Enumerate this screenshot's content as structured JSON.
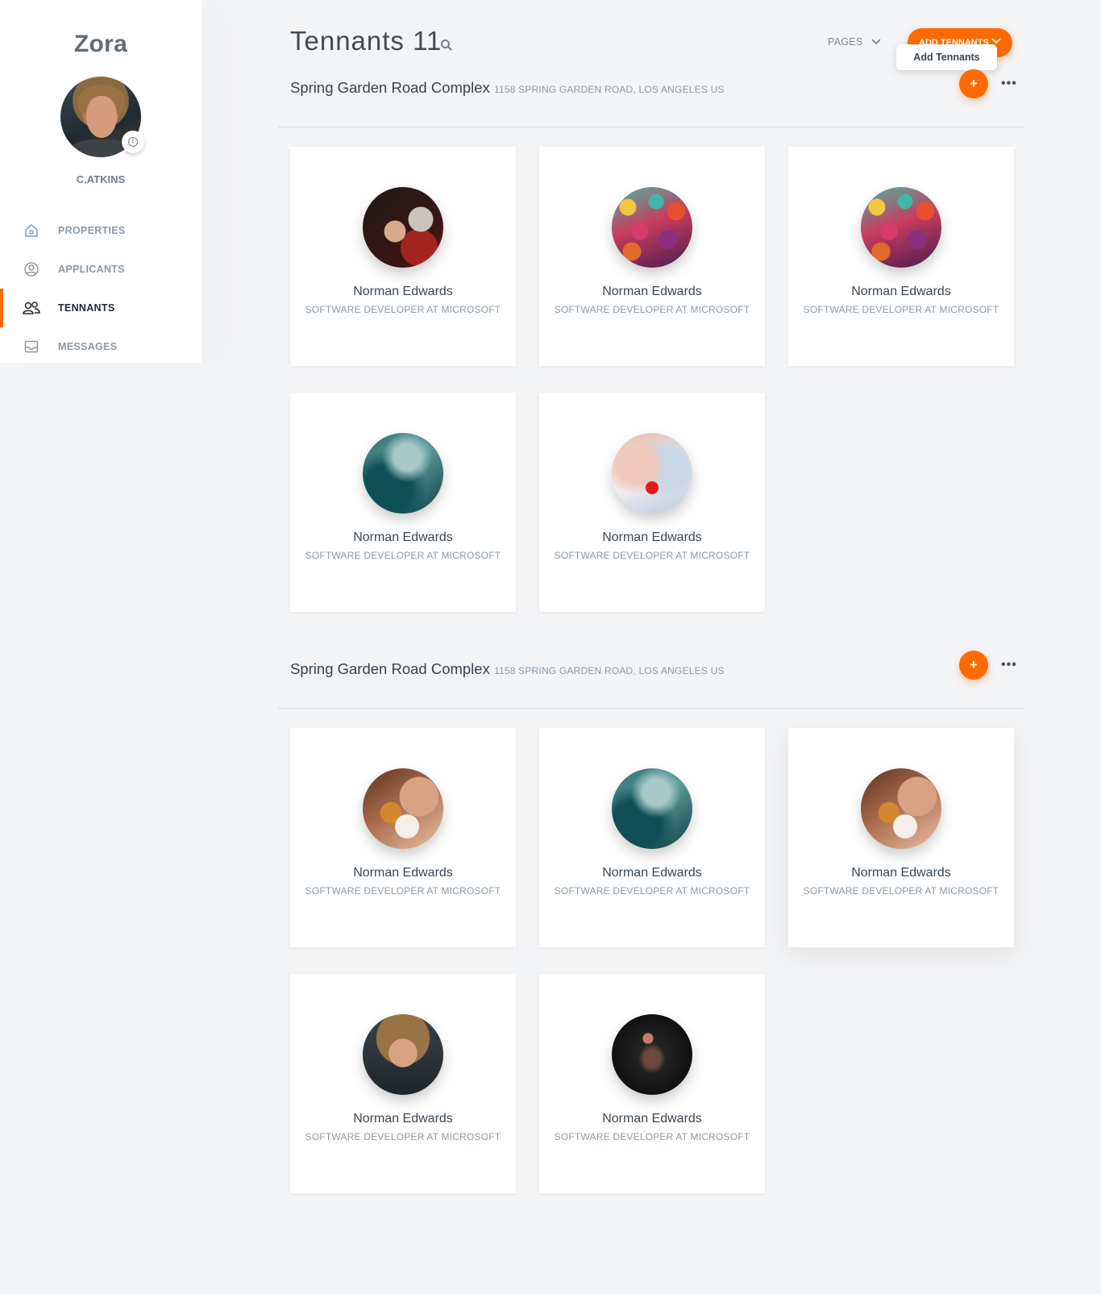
{
  "sidebar": {
    "brand": "Zora",
    "username": "C.ATKINS",
    "items": [
      {
        "label": "PROPERTIES",
        "icon": "home-icon"
      },
      {
        "label": "APPLICANTS",
        "icon": "user-circle-icon"
      },
      {
        "label": "TENNANTS",
        "icon": "users-icon",
        "active": true
      },
      {
        "label": "MESSAGES",
        "icon": "inbox-icon"
      }
    ]
  },
  "header": {
    "title": "Tennants 11",
    "pages_label": "PAGES",
    "add_button_label": "ADD TENNANTS",
    "tooltip": "Add Tennants"
  },
  "colors": {
    "accent": "#ff6a00",
    "background": "#f3f4f6"
  },
  "sections": [
    {
      "title": "Spring Garden Road Complex",
      "address": "1158 SPRING GARDEN ROAD, LOS ANGELES US",
      "add_symbol": "+",
      "more_symbol": "•••",
      "tenants": [
        {
          "name": "Norman Edwards",
          "role": "SOFTWARE DEVELOPER AT MICROSOFT"
        },
        {
          "name": "Norman Edwards",
          "role": "SOFTWARE DEVELOPER AT MICROSOFT"
        },
        {
          "name": "Norman Edwards",
          "role": "SOFTWARE DEVELOPER AT MICROSOFT"
        },
        {
          "name": "Norman Edwards",
          "role": "SOFTWARE DEVELOPER AT MICROSOFT"
        },
        {
          "name": "Norman Edwards",
          "role": "SOFTWARE DEVELOPER AT MICROSOFT"
        }
      ]
    },
    {
      "title": "Spring Garden Road Complex",
      "address": "1158 SPRING GARDEN ROAD, LOS ANGELES US",
      "add_symbol": "+",
      "more_symbol": "•••",
      "tenants": [
        {
          "name": "Norman Edwards",
          "role": "SOFTWARE DEVELOPER AT MICROSOFT"
        },
        {
          "name": "Norman Edwards",
          "role": "SOFTWARE DEVELOPER AT MICROSOFT"
        },
        {
          "name": "Norman Edwards",
          "role": "SOFTWARE DEVELOPER AT MICROSOFT"
        },
        {
          "name": "Norman Edwards",
          "role": "SOFTWARE DEVELOPER AT MICROSOFT"
        },
        {
          "name": "Norman Edwards",
          "role": "SOFTWARE DEVELOPER AT MICROSOFT"
        }
      ]
    }
  ]
}
